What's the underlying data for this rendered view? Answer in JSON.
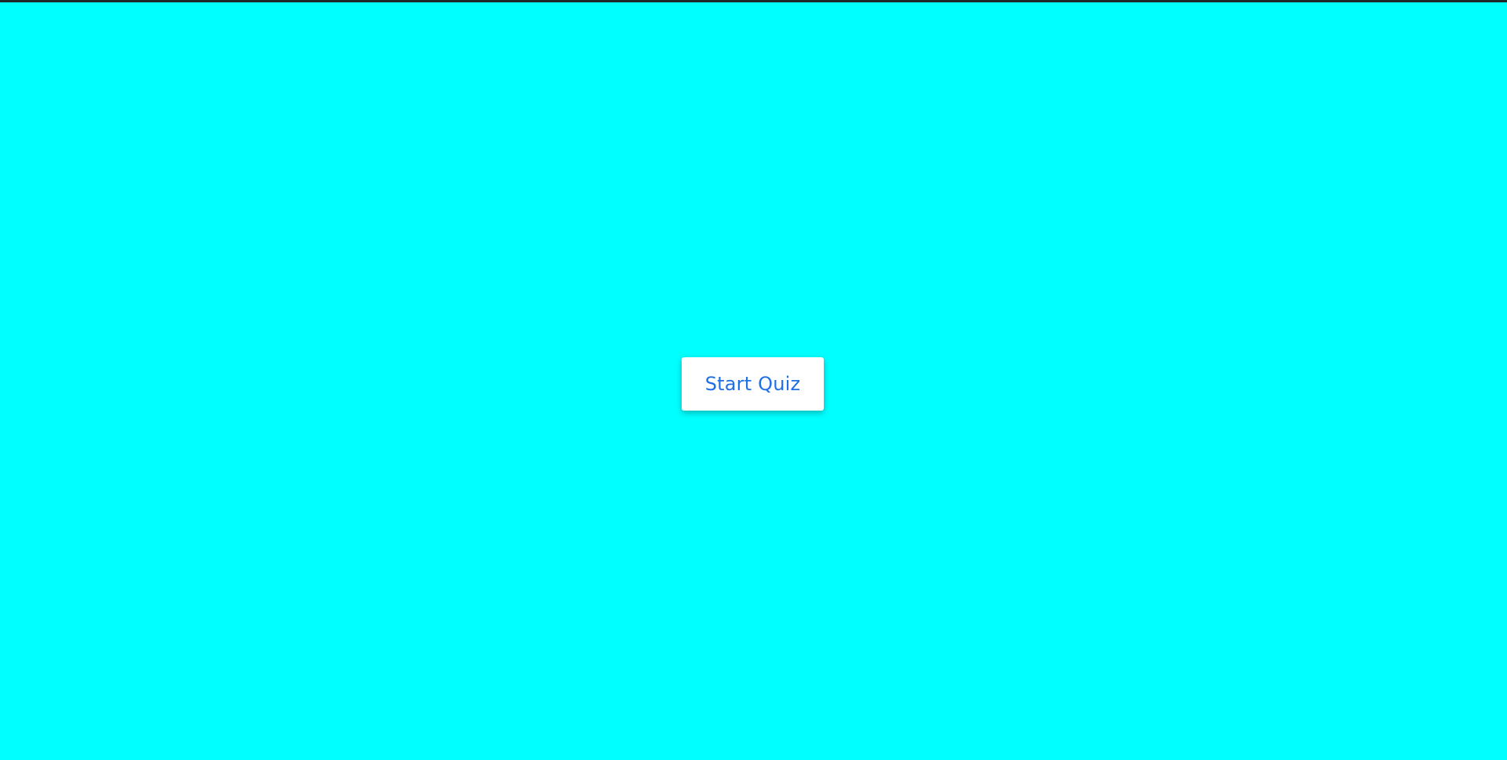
{
  "colors": {
    "page_background": "#00ffff",
    "top_border": "#1e2a2a",
    "button_background": "#ffffff",
    "button_text": "#1f6fe6"
  },
  "quiz": {
    "start_label": "Start Quiz"
  }
}
